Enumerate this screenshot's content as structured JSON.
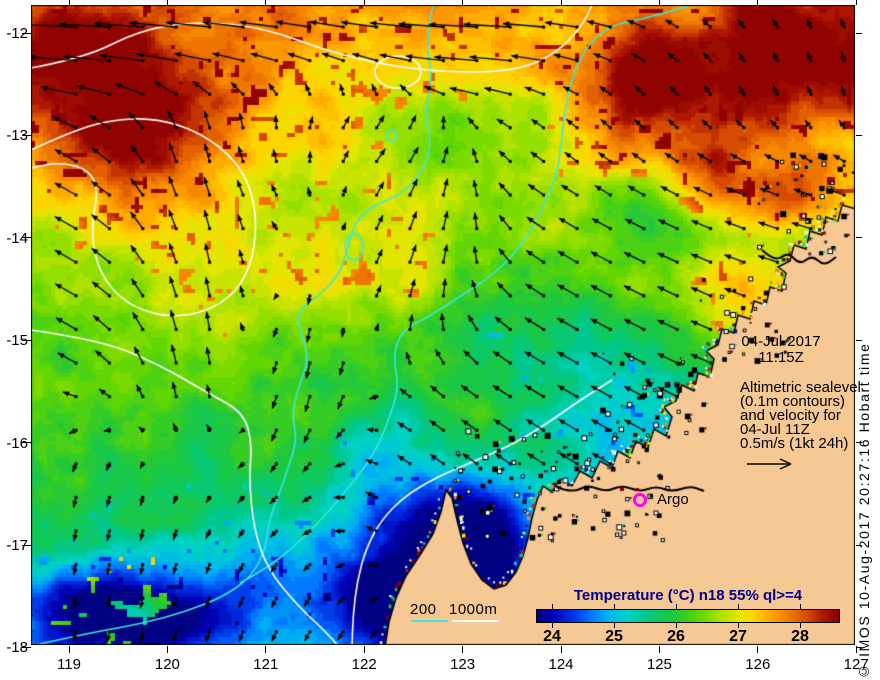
{
  "figure": {
    "date": "04-Jul-2017",
    "time": "11:15Z",
    "legend_lines": [
      "Altimetric sealevel",
      "(0.1m contours)",
      "and velocity for",
      "04-Jul 11Z",
      "0.5m/s (1kt 24h)"
    ],
    "argo_label": "Argo",
    "isobath_200": "200",
    "isobath_1000": "1000m",
    "copyright": "© IMOS 10-Aug-2017 20:27:16 Hobart time"
  },
  "axes": {
    "x_ticks": [
      "119",
      "120",
      "121",
      "122",
      "123",
      "124",
      "125",
      "126",
      "127"
    ],
    "y_ticks": [
      "-12",
      "-13",
      "-14",
      "-15",
      "-16",
      "-17",
      "-18"
    ]
  },
  "colorbar": {
    "title": "Temperature (°C) n18 55% ql>=4",
    "title_color": "#00008B",
    "ticks": [
      "24",
      "25",
      "26",
      "27",
      "28"
    ],
    "stops": [
      [
        0,
        "#000080"
      ],
      [
        0.05,
        "#0000B4"
      ],
      [
        0.12,
        "#0032E6"
      ],
      [
        0.18,
        "#0078FF"
      ],
      [
        0.24,
        "#00B4F0"
      ],
      [
        0.3,
        "#00D2C8"
      ],
      [
        0.36,
        "#00C88C"
      ],
      [
        0.42,
        "#14C850"
      ],
      [
        0.47,
        "#28C832"
      ],
      [
        0.54,
        "#64D700"
      ],
      [
        0.6,
        "#A0E100"
      ],
      [
        0.67,
        "#E6E600"
      ],
      [
        0.72,
        "#FFD200"
      ],
      [
        0.78,
        "#FFA000"
      ],
      [
        0.84,
        "#F07800"
      ],
      [
        0.9,
        "#D24600"
      ],
      [
        0.95,
        "#AA1400"
      ],
      [
        1,
        "#8B0000"
      ]
    ]
  },
  "map_colors": {
    "land": "#F6C894",
    "coast": "#000000",
    "sealevel_contour": "#FFFFFF",
    "bathy_contour": "#38E8DC",
    "arrow": "#000000",
    "argo_marker": "#FF00FF",
    "frame": "#000000"
  }
}
